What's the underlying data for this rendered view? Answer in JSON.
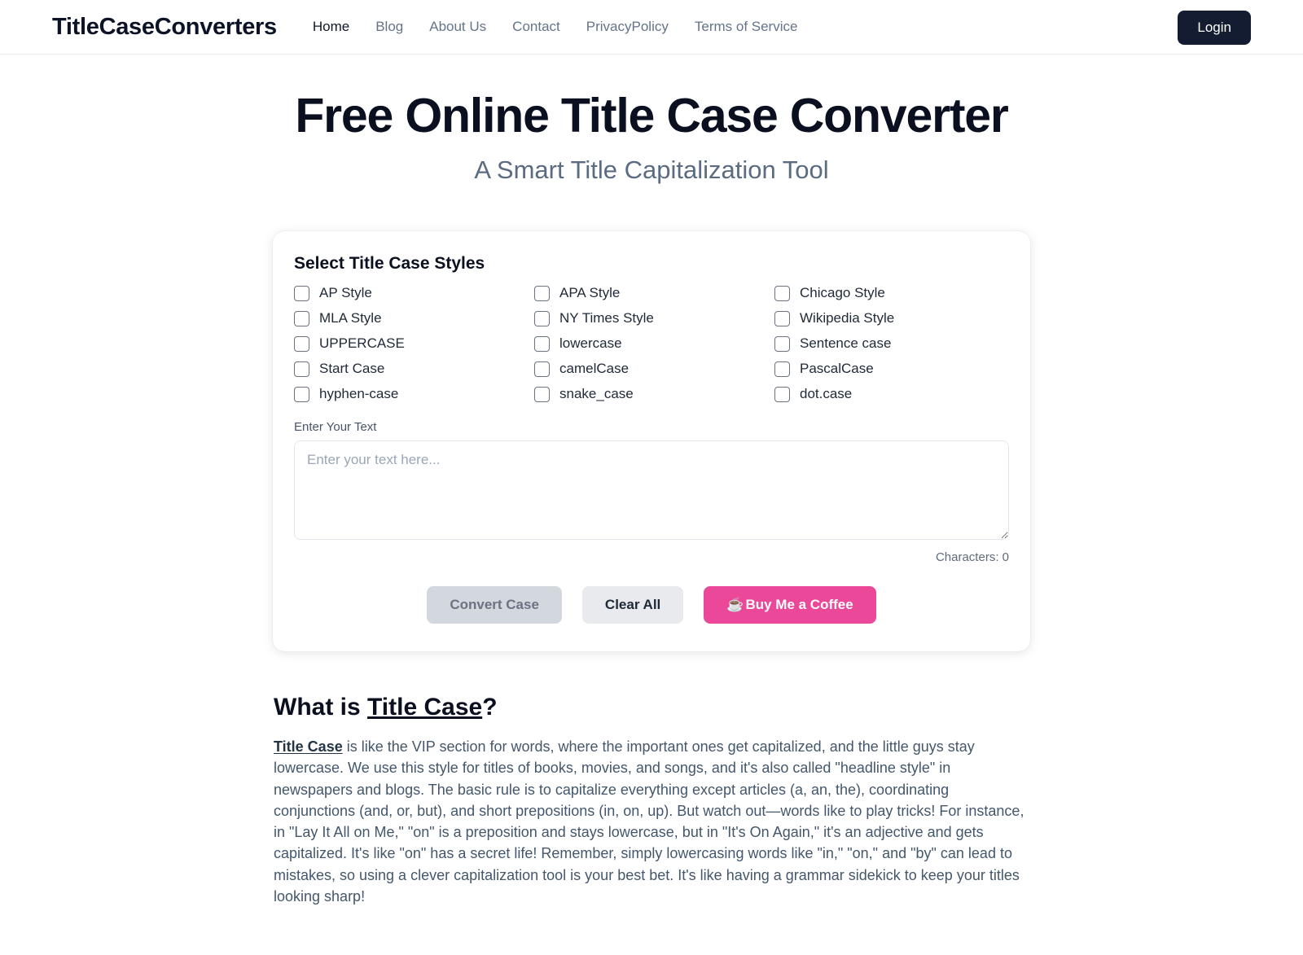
{
  "header": {
    "brand": "TitleCaseConverters",
    "nav": [
      {
        "label": "Home",
        "active": true
      },
      {
        "label": "Blog",
        "active": false
      },
      {
        "label": "About Us",
        "active": false
      },
      {
        "label": "Contact",
        "active": false
      },
      {
        "label": "PrivacyPolicy",
        "active": false
      },
      {
        "label": "Terms of Service",
        "active": false
      }
    ],
    "login_label": "Login",
    "login_bg": "#131c31"
  },
  "hero": {
    "title": "Free Online Title Case Converter",
    "subtitle": "A Smart Title Capitalization Tool"
  },
  "converter": {
    "section_title": "Select Title Case Styles",
    "styles": [
      {
        "label": "AP Style",
        "checked": false
      },
      {
        "label": "APA Style",
        "checked": false
      },
      {
        "label": "Chicago Style",
        "checked": false
      },
      {
        "label": "MLA Style",
        "checked": false
      },
      {
        "label": "NY Times Style",
        "checked": false
      },
      {
        "label": "Wikipedia Style",
        "checked": false
      },
      {
        "label": "UPPERCASE",
        "checked": false
      },
      {
        "label": "lowercase",
        "checked": false
      },
      {
        "label": "Sentence case",
        "checked": false
      },
      {
        "label": "Start Case",
        "checked": false
      },
      {
        "label": "camelCase",
        "checked": false
      },
      {
        "label": "PascalCase",
        "checked": false
      },
      {
        "label": "hyphen-case",
        "checked": false
      },
      {
        "label": "snake_case",
        "checked": false
      },
      {
        "label": "dot.case",
        "checked": false
      }
    ],
    "input_label": "Enter Your Text",
    "input_placeholder": "Enter your text here...",
    "input_value": "",
    "char_count": "Characters: 0",
    "buttons": {
      "convert": "Convert Case",
      "clear": "Clear All",
      "coffee": "Buy Me a Coffee",
      "coffee_icon": "coffee-cup-icon",
      "coffee_glyph": "☕",
      "coffee_bg": "#ec4899"
    }
  },
  "article": {
    "heading_prefix": "What is ",
    "heading_link": "Title Case",
    "heading_suffix": "?",
    "lead_term": "Title Case",
    "body": " is like the VIP section for words, where the important ones get capitalized, and the little guys stay lowercase. We use this style for titles of books, movies, and songs, and it's also called \"headline style\" in newspapers and blogs. The basic rule is to capitalize everything except articles (a, an, the), coordinating conjunctions (and, or, but), and short prepositions (in, on, up). But watch out—words like to play tricks! For instance, in \"Lay It All on Me,\" \"on\" is a preposition and stays lowercase, but in \"It's On Again,\" it's an adjective and gets capitalized. It's like \"on\" has a secret life! Remember, simply lowercasing words like \"in,\" \"on,\" and \"by\" can lead to mistakes, so using a clever capitalization tool is your best bet. It's like having a grammar sidekick to keep your titles looking sharp!"
  }
}
